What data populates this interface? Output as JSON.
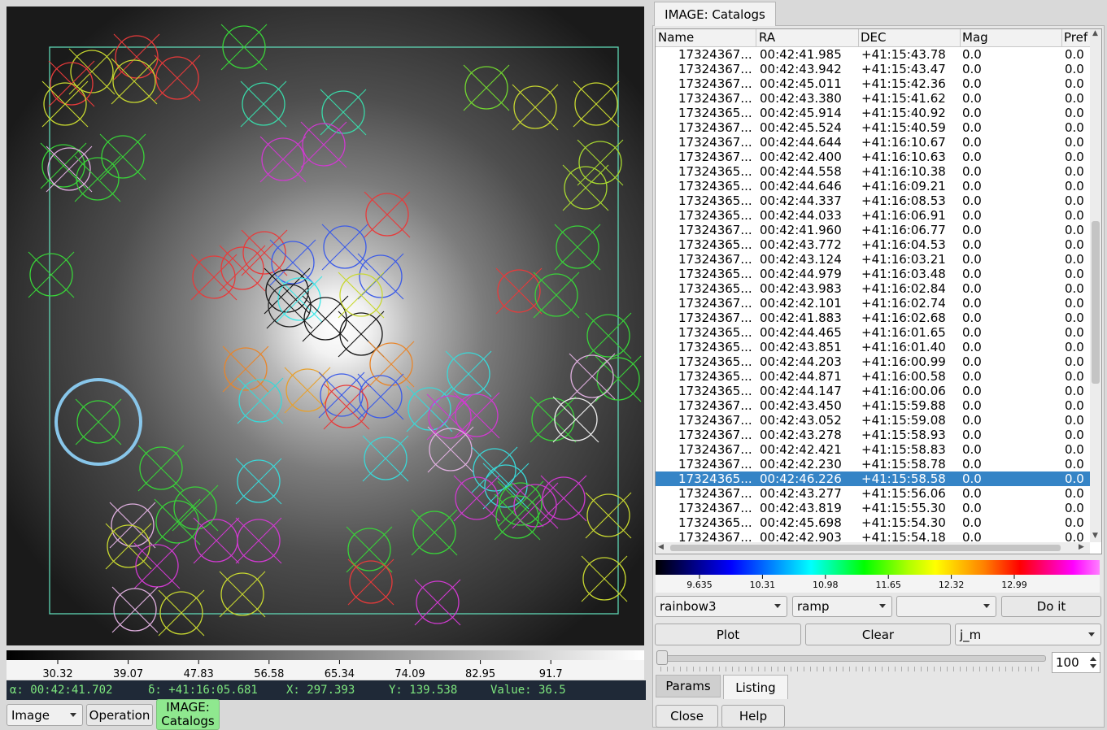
{
  "left": {
    "colorbar_ticks": [
      "30.32",
      "39.07",
      "47.83",
      "56.58",
      "65.34",
      "74.09",
      "82.95",
      "91.7"
    ],
    "status": {
      "ra": "α: 00:42:41.702",
      "dec": "δ: +41:16:05.681",
      "x": "X: 297.393",
      "y": "Y: 139.538",
      "value": "Value: 36.5"
    },
    "bottom": {
      "image_menu": "Image",
      "operation_button": "Operation",
      "catalogs_tab_line1": "IMAGE:",
      "catalogs_tab_line2": "Catalogs"
    }
  },
  "right": {
    "tab_title": "IMAGE: Catalogs",
    "columns": [
      "Name",
      "RA",
      "DEC",
      "Mag",
      "Pref"
    ],
    "rows": [
      [
        "17324367...",
        "00:42:41.985",
        "+41:15:43.78",
        "0.0",
        "0.0"
      ],
      [
        "17324367...",
        "00:42:43.942",
        "+41:15:43.47",
        "0.0",
        "0.0"
      ],
      [
        "17324367...",
        "00:42:45.011",
        "+41:15:42.36",
        "0.0",
        "0.0"
      ],
      [
        "17324367...",
        "00:42:43.380",
        "+41:15:41.62",
        "0.0",
        "0.0"
      ],
      [
        "17324365...",
        "00:42:45.914",
        "+41:15:40.92",
        "0.0",
        "0.0"
      ],
      [
        "17324367...",
        "00:42:45.524",
        "+41:15:40.59",
        "0.0",
        "0.0"
      ],
      [
        "17324367...",
        "00:42:44.644",
        "+41:16:10.67",
        "0.0",
        "0.0"
      ],
      [
        "17324367...",
        "00:42:42.400",
        "+41:16:10.63",
        "0.0",
        "0.0"
      ],
      [
        "17324365...",
        "00:42:44.558",
        "+41:16:10.38",
        "0.0",
        "0.0"
      ],
      [
        "17324365...",
        "00:42:44.646",
        "+41:16:09.21",
        "0.0",
        "0.0"
      ],
      [
        "17324365...",
        "00:42:44.337",
        "+41:16:08.53",
        "0.0",
        "0.0"
      ],
      [
        "17324365...",
        "00:42:44.033",
        "+41:16:06.91",
        "0.0",
        "0.0"
      ],
      [
        "17324367...",
        "00:42:41.960",
        "+41:16:06.77",
        "0.0",
        "0.0"
      ],
      [
        "17324365...",
        "00:42:43.772",
        "+41:16:04.53",
        "0.0",
        "0.0"
      ],
      [
        "17324367...",
        "00:42:43.124",
        "+41:16:03.21",
        "0.0",
        "0.0"
      ],
      [
        "17324365...",
        "00:42:44.979",
        "+41:16:03.48",
        "0.0",
        "0.0"
      ],
      [
        "17324365...",
        "00:42:43.983",
        "+41:16:02.84",
        "0.0",
        "0.0"
      ],
      [
        "17324367...",
        "00:42:42.101",
        "+41:16:02.74",
        "0.0",
        "0.0"
      ],
      [
        "17324367...",
        "00:42:41.883",
        "+41:16:02.68",
        "0.0",
        "0.0"
      ],
      [
        "17324365...",
        "00:42:44.465",
        "+41:16:01.65",
        "0.0",
        "0.0"
      ],
      [
        "17324365...",
        "00:42:43.851",
        "+41:16:01.40",
        "0.0",
        "0.0"
      ],
      [
        "17324365...",
        "00:42:44.203",
        "+41:16:00.99",
        "0.0",
        "0.0"
      ],
      [
        "17324365...",
        "00:42:44.871",
        "+41:16:00.58",
        "0.0",
        "0.0"
      ],
      [
        "17324365...",
        "00:42:44.147",
        "+41:16:00.06",
        "0.0",
        "0.0"
      ],
      [
        "17324367...",
        "00:42:43.450",
        "+41:15:59.88",
        "0.0",
        "0.0"
      ],
      [
        "17324367...",
        "00:42:43.052",
        "+41:15:59.08",
        "0.0",
        "0.0"
      ],
      [
        "17324367...",
        "00:42:43.278",
        "+41:15:58.93",
        "0.0",
        "0.0"
      ],
      [
        "17324367...",
        "00:42:42.421",
        "+41:15:58.83",
        "0.0",
        "0.0"
      ],
      [
        "17324367...",
        "00:42:42.230",
        "+41:15:58.78",
        "0.0",
        "0.0"
      ],
      [
        "17324365...",
        "00:42:46.226",
        "+41:15:58.58",
        "0.0",
        "0.0"
      ],
      [
        "17324367...",
        "00:42:43.277",
        "+41:15:56.06",
        "0.0",
        "0.0"
      ],
      [
        "17324367...",
        "00:42:43.819",
        "+41:15:55.30",
        "0.0",
        "0.0"
      ],
      [
        "17324365...",
        "00:42:45.698",
        "+41:15:54.30",
        "0.0",
        "0.0"
      ],
      [
        "17324367...",
        "00:42:42.903",
        "+41:15:54.18",
        "0.0",
        "0.0"
      ]
    ],
    "selected_row": 29,
    "colorbar_ticks": [
      "9.635",
      "10.31",
      "10.98",
      "11.65",
      "12.32",
      "12.99"
    ],
    "colormap": "rainbow3",
    "scale": "ramp",
    "third_combo": "",
    "do_it": "Do it",
    "plot": "Plot",
    "clear": "Clear",
    "field": "j_m",
    "slider_value": "100",
    "tab_params": "Params",
    "tab_listing": "Listing",
    "close": "Close",
    "help": "Help"
  }
}
